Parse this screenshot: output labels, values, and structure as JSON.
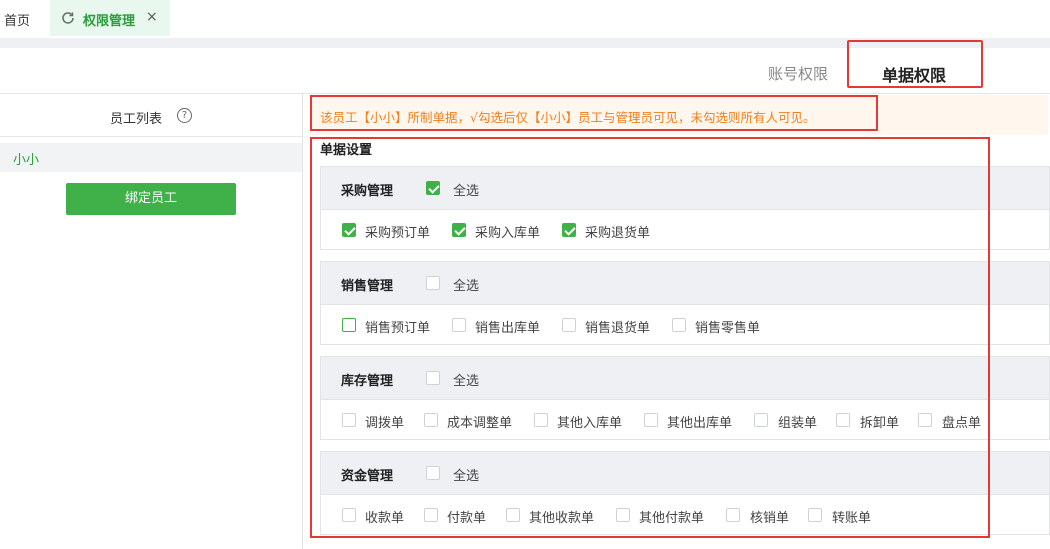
{
  "tabs": {
    "home_label": "首页",
    "active_label": "权限管理",
    "close_glyph": "×"
  },
  "subtabs": {
    "account": "账号权限",
    "document": "单据权限"
  },
  "left": {
    "title": "员工列表",
    "help_glyph": "?",
    "employee": "小小",
    "bind_button": "绑定员工"
  },
  "notice": "该员工【小小】所制单据，√勾选后仅【小小】员工与管理员可见，未勾选则所有人可见。",
  "settings_title": "单据设置",
  "groups": {
    "purchase": {
      "name": "采购管理",
      "select_all": "全选",
      "items": [
        "采购预订单",
        "采购入库单",
        "采购退货单"
      ]
    },
    "sales": {
      "name": "销售管理",
      "select_all": "全选",
      "items": [
        "销售预订单",
        "销售出库单",
        "销售退货单",
        "销售零售单"
      ]
    },
    "inventory": {
      "name": "库存管理",
      "select_all": "全选",
      "items": [
        "调拨单",
        "成本调整单",
        "其他入库单",
        "其他出库单",
        "组装单",
        "拆卸单",
        "盘点单"
      ]
    },
    "finance": {
      "name": "资金管理",
      "select_all": "全选",
      "items": [
        "收款单",
        "付款单",
        "其他收款单",
        "其他付款单",
        "核销单",
        "转账单"
      ]
    }
  },
  "colors": {
    "accent_green": "#3fb148",
    "notice_orange": "#f07f1f",
    "highlight_red": "#e53935"
  }
}
